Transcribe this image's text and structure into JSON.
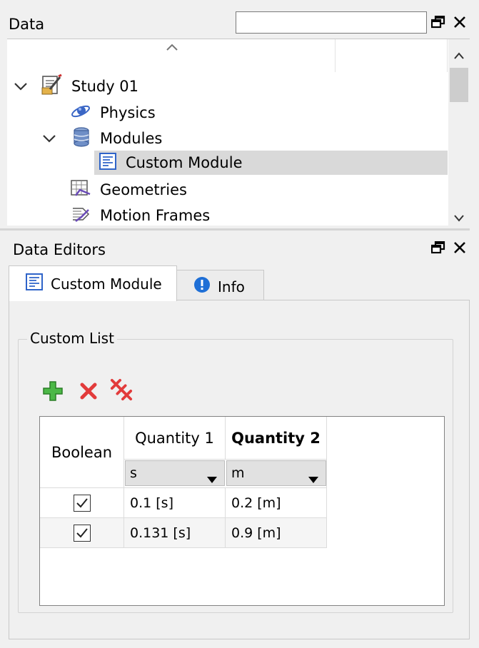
{
  "data_panel": {
    "title": "Data",
    "search_value": "",
    "tree": [
      {
        "label": "Study 01",
        "icon": "study-icon",
        "expanded": true
      },
      {
        "label": "Physics",
        "icon": "physics-icon"
      },
      {
        "label": "Modules",
        "icon": "modules-icon",
        "expanded": true
      },
      {
        "label": "Custom Module",
        "icon": "module-doc-icon",
        "selected": true
      },
      {
        "label": "Geometries",
        "icon": "geometries-icon"
      },
      {
        "label": "Motion Frames",
        "icon": "motion-frames-icon"
      }
    ]
  },
  "editors_panel": {
    "title": "Data Editors",
    "tabs": [
      {
        "label": "Custom Module",
        "icon": "module-doc-icon",
        "active": true
      },
      {
        "label": "Info",
        "icon": "info-icon",
        "active": false
      }
    ],
    "group_title": "Custom List",
    "toolbar": {
      "add": "add-icon",
      "remove": "remove-icon",
      "remove_all": "remove-all-icon"
    },
    "table": {
      "columns": [
        {
          "label": "Boolean",
          "unit": ""
        },
        {
          "label": "Quantity 1",
          "unit": "s"
        },
        {
          "label": "Quantity 2",
          "unit": "m",
          "bold": true
        }
      ],
      "rows": [
        {
          "checked": true,
          "q1": "0.1 [s]",
          "q2": "0.2 [m]"
        },
        {
          "checked": true,
          "q1": "0.131 [s]",
          "q2": "0.9 [m]"
        }
      ]
    }
  },
  "colors": {
    "add_green": "#3aa536",
    "remove_red": "#e23b3b",
    "info_blue": "#1f6fd6",
    "selection": "#d9d9d9"
  }
}
